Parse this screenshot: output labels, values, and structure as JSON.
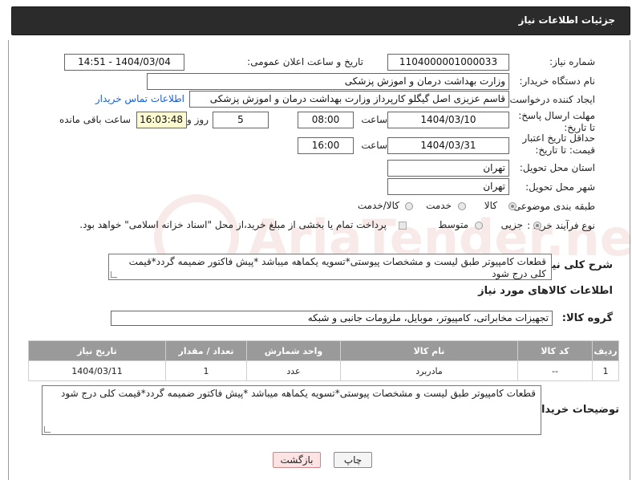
{
  "header": {
    "title": "جزئیات اطلاعات نیاز"
  },
  "fields": {
    "need_number": {
      "label": "شماره نیاز:",
      "value": "1104000001000033"
    },
    "announce": {
      "label": "تاریخ و ساعت اعلان عمومی:",
      "value": "1404/03/04 - 14:51"
    },
    "buyer_org": {
      "label": "نام دستگاه خریدار:",
      "value": "وزارت بهداشت  درمان و اموزش پزشکی"
    },
    "requester": {
      "label": "ایجاد کننده درخواست:",
      "value": "قاسم عزیزی اصل گیگلو کارپرداز وزارت بهداشت  درمان و اموزش پزشکی",
      "contact_link": "اطلاعات تماس خریدار"
    },
    "deadline": {
      "label": "مهلت ارسال پاسخ: تا تاریخ:",
      "date": "1404/03/10",
      "time_label": "ساعت",
      "time": "08:00",
      "days": "5",
      "days_label": "روز و",
      "remaining": "16:03:48",
      "remaining_label": "ساعت باقی مانده"
    },
    "validity": {
      "label": "حداقل تاریخ اعتبار قیمت: تا تاریخ:",
      "date": "1404/03/31",
      "time_label": "ساعت",
      "time": "16:00"
    },
    "province": {
      "label": "استان محل تحویل:",
      "value": "تهران"
    },
    "city": {
      "label": "شهر محل تحویل:",
      "value": "تهران"
    },
    "category": {
      "label": "طبقه بندی موضوعی:",
      "options": [
        "کالا",
        "خدمت",
        "کالا/خدمت"
      ],
      "selected": "کالا"
    },
    "process": {
      "label": "نوع فرآیند خرید :",
      "options": [
        "جزیی",
        "متوسط"
      ],
      "selected": "جزیی",
      "payment_note": "پرداخت تمام یا بخشی از مبلغ خرید،از محل \"اسناد خزانه اسلامی\" خواهد بود."
    },
    "description": {
      "label": "شرح کلی نیاز:",
      "value": "قطعات کامپیوتر طبق لیست و مشخصات پیوستی*تسویه یکماهه میباشد *پیش فاکتور ضمیمه گردد*قیمت کلی درج شود"
    }
  },
  "goods": {
    "section_title": "اطلاعات کالاهای مورد نیاز",
    "group_label": "گروه کالا:",
    "group_value": "تجهیزات مخابراتی، کامپیوتر، موبایل، ملزومات جانبی و شبکه",
    "columns": [
      "ردیف",
      "کد کالا",
      "نام کالا",
      "واحد شمارش",
      "تعداد / مقدار",
      "تاریخ نیاز"
    ],
    "rows": [
      {
        "row": "1",
        "code": "--",
        "name": "مادربرد",
        "unit": "عدد",
        "qty": "1",
        "date": "1404/03/11"
      }
    ]
  },
  "buyer_notes": {
    "label": "توضیحات خریدار:",
    "value": "قطعات کامپیوتر طبق لیست و مشخصات پیوستی*تسویه یکماهه میباشد *پیش فاکتور ضمیمه گردد*قیمت کلی درج شود"
  },
  "buttons": {
    "print": "چاپ",
    "back": "بازگشت"
  },
  "watermark": {
    "text": "AriaTender.net",
    "color": "#c0392b"
  }
}
